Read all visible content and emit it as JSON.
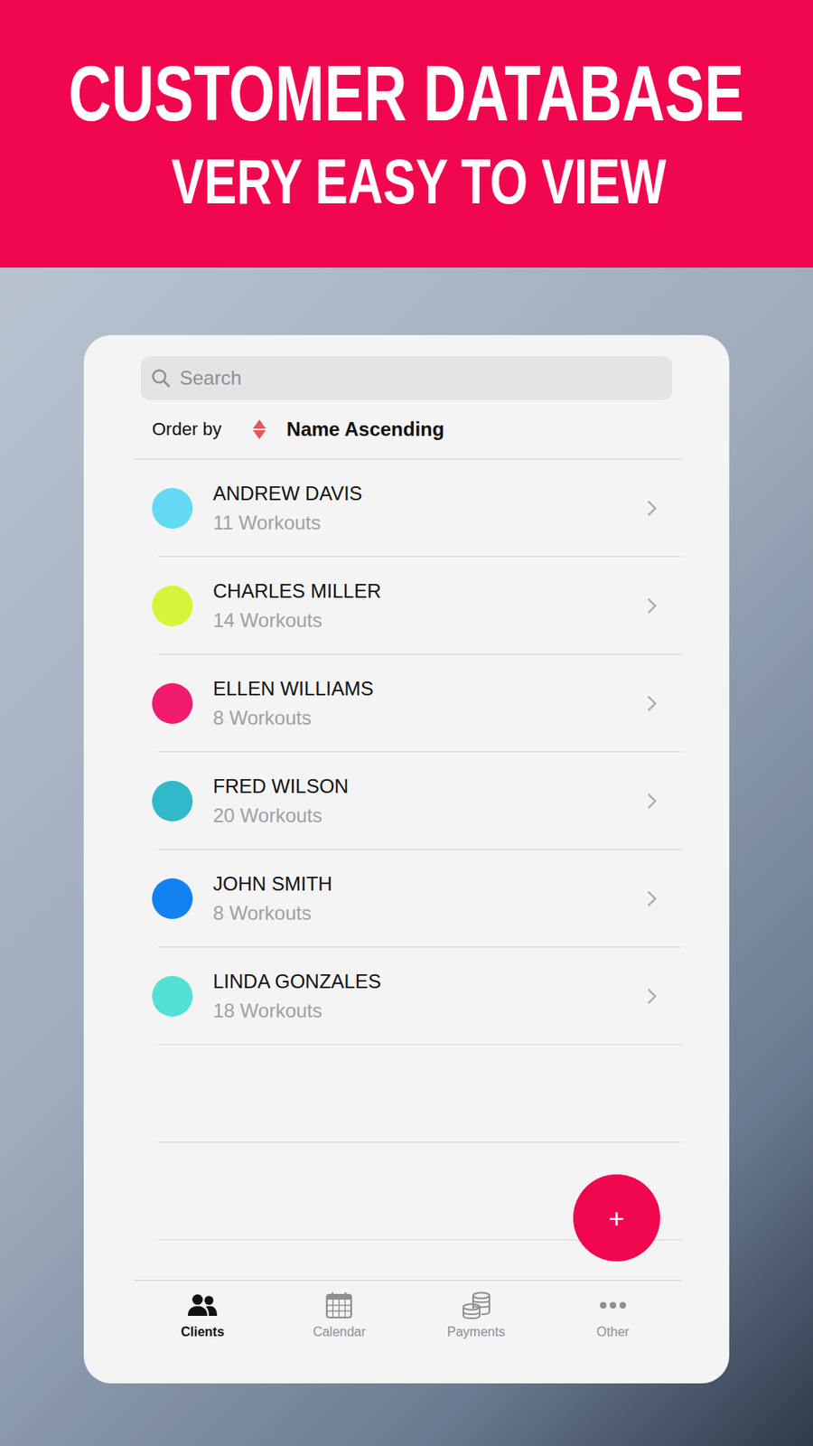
{
  "banner": {
    "title": "CUSTOMER DATABASE",
    "subtitle": "VERY EASY TO VIEW"
  },
  "search": {
    "placeholder": "Search"
  },
  "sort": {
    "label": "Order by",
    "value": "Name Ascending"
  },
  "clients": [
    {
      "name": "ANDREW DAVIS",
      "workouts": "11 Workouts",
      "color": "#63d9f3"
    },
    {
      "name": "CHARLES MILLER",
      "workouts": "14 Workouts",
      "color": "#d4f53a"
    },
    {
      "name": "ELLEN WILLIAMS",
      "workouts": "8 Workouts",
      "color": "#f01a6e"
    },
    {
      "name": "FRED WILSON",
      "workouts": "20 Workouts",
      "color": "#31b9c9"
    },
    {
      "name": "JOHN SMITH",
      "workouts": "8 Workouts",
      "color": "#1282f0"
    },
    {
      "name": "LINDA GONZALES",
      "workouts": "18 Workouts",
      "color": "#55e0d5"
    }
  ],
  "fab": {
    "label": "+"
  },
  "tabs": [
    {
      "label": "Clients",
      "selected": true
    },
    {
      "label": "Calendar",
      "selected": false
    },
    {
      "label": "Payments",
      "selected": false
    },
    {
      "label": "Other",
      "selected": false
    }
  ]
}
